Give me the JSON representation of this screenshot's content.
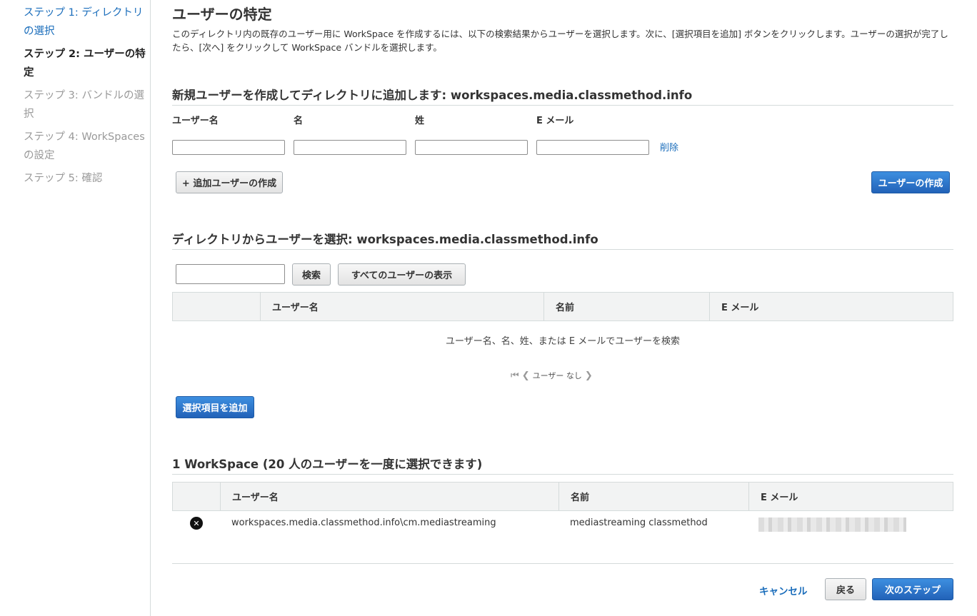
{
  "sidebar": {
    "steps": [
      {
        "label": "ステップ 1: ディレクトリの選択",
        "state": "done"
      },
      {
        "label": "ステップ 2: ユーザーの特定",
        "state": "current"
      },
      {
        "label": "ステップ 3: バンドルの選択",
        "state": "todo"
      },
      {
        "label": "ステップ 4: WorkSpaces の設定",
        "state": "todo"
      },
      {
        "label": "ステップ 5: 確認",
        "state": "todo"
      }
    ]
  },
  "page": {
    "title": "ユーザーの特定",
    "intro": "このディレクトリ内の既存のユーザー用に WorkSpace を作成するには、以下の検索結果からユーザーを選択します。次に、[選択項目を追加] ボタンをクリックします。ユーザーの選択が完了したら、[次へ] をクリックして WorkSpace バンドルを選択します。"
  },
  "create_section": {
    "title": "新規ユーザーを作成してディレクトリに追加します: workspaces.media.classmethod.info",
    "labels": {
      "username": "ユーザー名",
      "first_name": "名",
      "last_name": "姓",
      "email": "E メール"
    },
    "values": {
      "username": "",
      "first_name": "",
      "last_name": "",
      "email": ""
    },
    "delete_link": "削除",
    "add_more_button": "+ 追加ユーザーの作成",
    "create_button": "ユーザーの作成"
  },
  "select_section": {
    "title": "ディレクトリからユーザーを選択: workspaces.media.classmethod.info",
    "search_value": "",
    "search_button": "検索",
    "show_all_button": "すべてのユーザーの表示",
    "columns": [
      "ユーザー名",
      "名前",
      "E メール"
    ],
    "empty_message": "ユーザー名、名、姓、または E メールでユーザーを検索",
    "pager_text": "ユーザー なし",
    "add_selected_button": "選択項目を追加"
  },
  "selected_section": {
    "title": "1 WorkSpace (20 人のユーザーを一度に選択できます)",
    "columns": [
      "ユーザー名",
      "名前",
      "E メール"
    ],
    "rows": [
      {
        "username": "workspaces.media.classmethod.info\\cm.mediastreaming",
        "name": "mediastreaming classmethod",
        "email": ""
      }
    ]
  },
  "footer": {
    "cancel": "キャンセル",
    "back": "戻る",
    "next": "次のステップ"
  },
  "colors": {
    "link": "#1a6dbb",
    "primary": "#2262b8",
    "border": "#d5dbdb"
  }
}
